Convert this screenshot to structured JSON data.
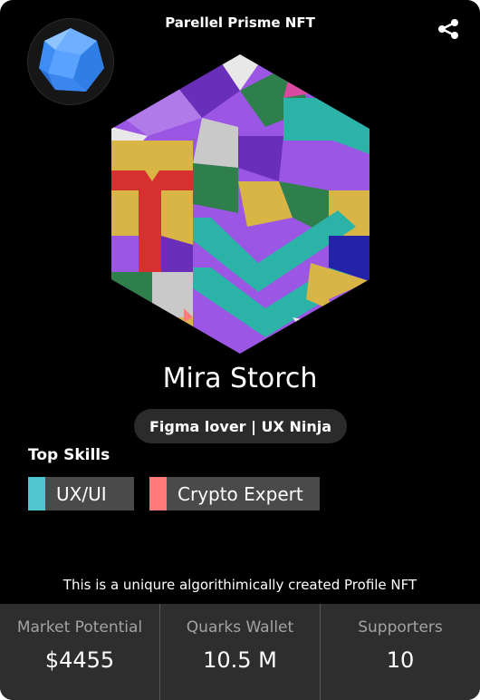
{
  "header": {
    "title": "Parellel Prisme NFT",
    "share_icon": "share-icon",
    "logo_icon": "polyhedron-logo-icon"
  },
  "profile": {
    "name": "Mira Storch",
    "tagline": "Figma lover | UX Ninja",
    "avatar": "geometric-hexagon-avatar"
  },
  "skills": {
    "heading": "Top Skills",
    "items": [
      {
        "label": "UX/UI",
        "color": "#4fc6cf"
      },
      {
        "label": "Crypto Expert",
        "color": "#ff7a7a"
      }
    ]
  },
  "description": "This is a uniqure algorithimically created Profile NFT",
  "stats": [
    {
      "label": "Market Potential",
      "value": "$4455"
    },
    {
      "label": "Quarks Wallet",
      "value": "10.5 M"
    },
    {
      "label": "Supporters",
      "value": "10"
    }
  ],
  "colors": {
    "background": "#000000",
    "stats_background": "#2e2e2e",
    "pill_background": "#2b2b2b",
    "logo_blue": "#3d8df5",
    "purple": "#9b57e4",
    "teal": "#2bb3a8",
    "red": "#d63030",
    "yellow": "#d9b545"
  }
}
